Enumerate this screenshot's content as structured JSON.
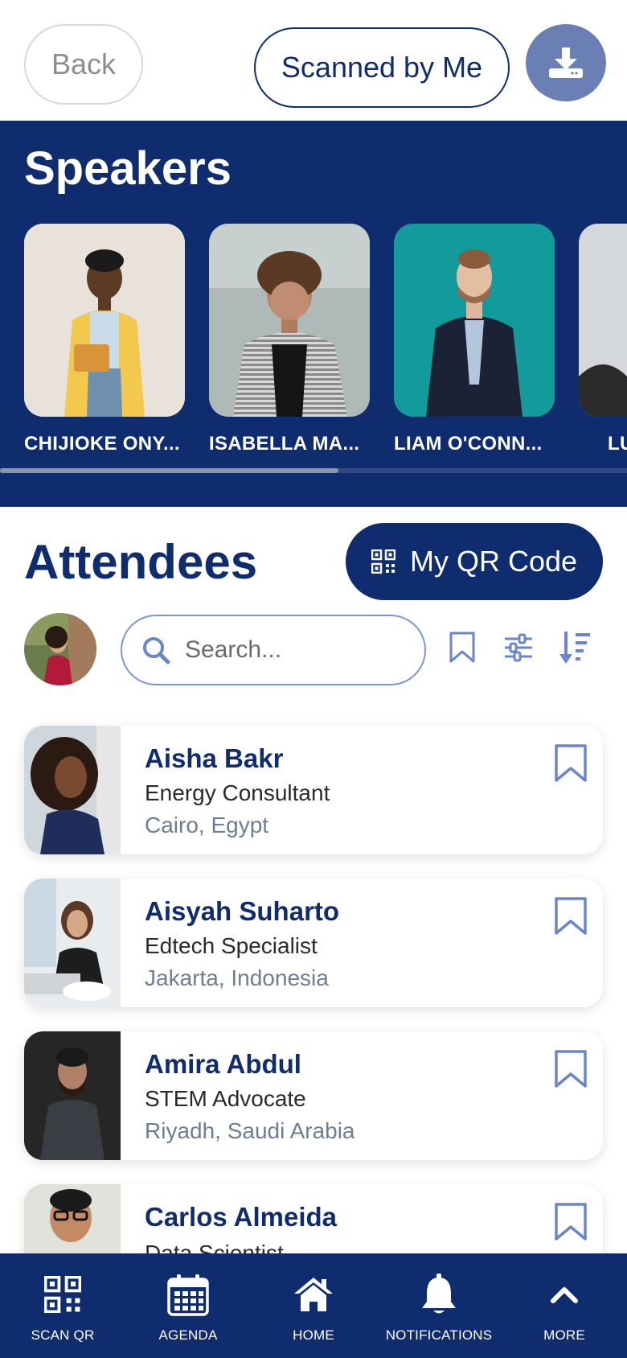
{
  "header": {
    "back_label": "Back",
    "scanned_label": "Scanned by Me",
    "download_icon": "download-icon"
  },
  "speakers": {
    "title": "Speakers",
    "items": [
      {
        "name": "CHIJIOKE ONY..."
      },
      {
        "name": "ISABELLA MA..."
      },
      {
        "name": "LIAM O'CONN..."
      },
      {
        "name": "LU"
      }
    ],
    "scroll_fraction": 0.54
  },
  "attendees": {
    "title": "Attendees",
    "qr_label": "My QR Code",
    "search_placeholder": "Search...",
    "items": [
      {
        "name": "Aisha Bakr",
        "role": "Energy Consultant",
        "location": "Cairo, Egypt"
      },
      {
        "name": "Aisyah Suharto",
        "role": "Edtech Specialist",
        "location": "Jakarta, Indonesia"
      },
      {
        "name": "Amira Abdul",
        "role": "STEM Advocate",
        "location": "Riyadh, Saudi Arabia"
      },
      {
        "name": "Carlos Almeida",
        "role": "Data Scientist",
        "location": ""
      }
    ]
  },
  "nav": {
    "items": [
      {
        "label": "SCAN QR",
        "icon": "qr-code-icon"
      },
      {
        "label": "AGENDA",
        "icon": "calendar-icon"
      },
      {
        "label": "HOME",
        "icon": "home-icon"
      },
      {
        "label": "NOTIFICATIONS",
        "icon": "bell-icon"
      },
      {
        "label": "MORE",
        "icon": "chevron-up-icon"
      }
    ]
  },
  "colors": {
    "primary": "#0f2c6e",
    "accent": "#6a7fb3",
    "search_border": "#7a96d6"
  }
}
